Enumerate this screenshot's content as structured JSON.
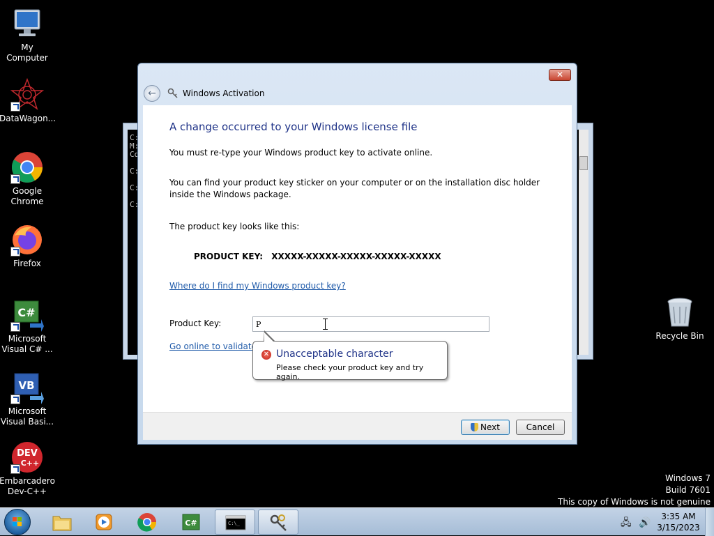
{
  "desktop": {
    "icons": [
      {
        "label": "My Computer"
      },
      {
        "label": "DataWagon..."
      },
      {
        "label": "Google Chrome"
      },
      {
        "label": "Firefox"
      },
      {
        "label": "Microsoft Visual C# ..."
      },
      {
        "label": "Microsoft Visual Basi..."
      },
      {
        "label": "Embarcadero Dev-C++"
      },
      {
        "label": "Recycle Bin"
      }
    ]
  },
  "console": {
    "lines": [
      "C:\\",
      "M:",
      "Co",
      "",
      "C:",
      "",
      "C:",
      "",
      "C:"
    ]
  },
  "dialog": {
    "close_label": "✕",
    "back_icon": "←",
    "title": "Windows Activation",
    "heading": "A change occurred to your Windows license file",
    "line1": "You must re-type your Windows product key to activate online.",
    "line2": "You can find your product key sticker on your computer or on the installation disc holder inside the Windows package.",
    "line3": "The product key looks like this:",
    "product_key_label": "PRODUCT KEY:",
    "product_key_example": "XXXXX-XXXXX-XXXXX-XXXXX-XXXXX",
    "help_link": "Where do I find my Windows product key?",
    "input_label": "Product Key:",
    "input_value": "P",
    "online_link": "Go online to validate",
    "next_label": "Next",
    "cancel_label": "Cancel"
  },
  "balloon": {
    "title": "Unacceptable character",
    "message": "Please check your product key and try again."
  },
  "watermark": {
    "line1": "Windows 7",
    "line2": "Build 7601",
    "line3": "This copy of Windows is not genuine"
  },
  "taskbar": {
    "items": [
      "windows-explorer",
      "media-player",
      "google-chrome",
      "visual-csharp",
      "command-prompt",
      "windows-activation"
    ],
    "tray_icons": [
      "network-icon",
      "volume-icon"
    ],
    "time": "3:35 AM",
    "date": "3/15/2023"
  },
  "colors": {
    "heading": "#1e3287",
    "link": "#1f5aa9",
    "taskbar": "#b4c8de"
  }
}
